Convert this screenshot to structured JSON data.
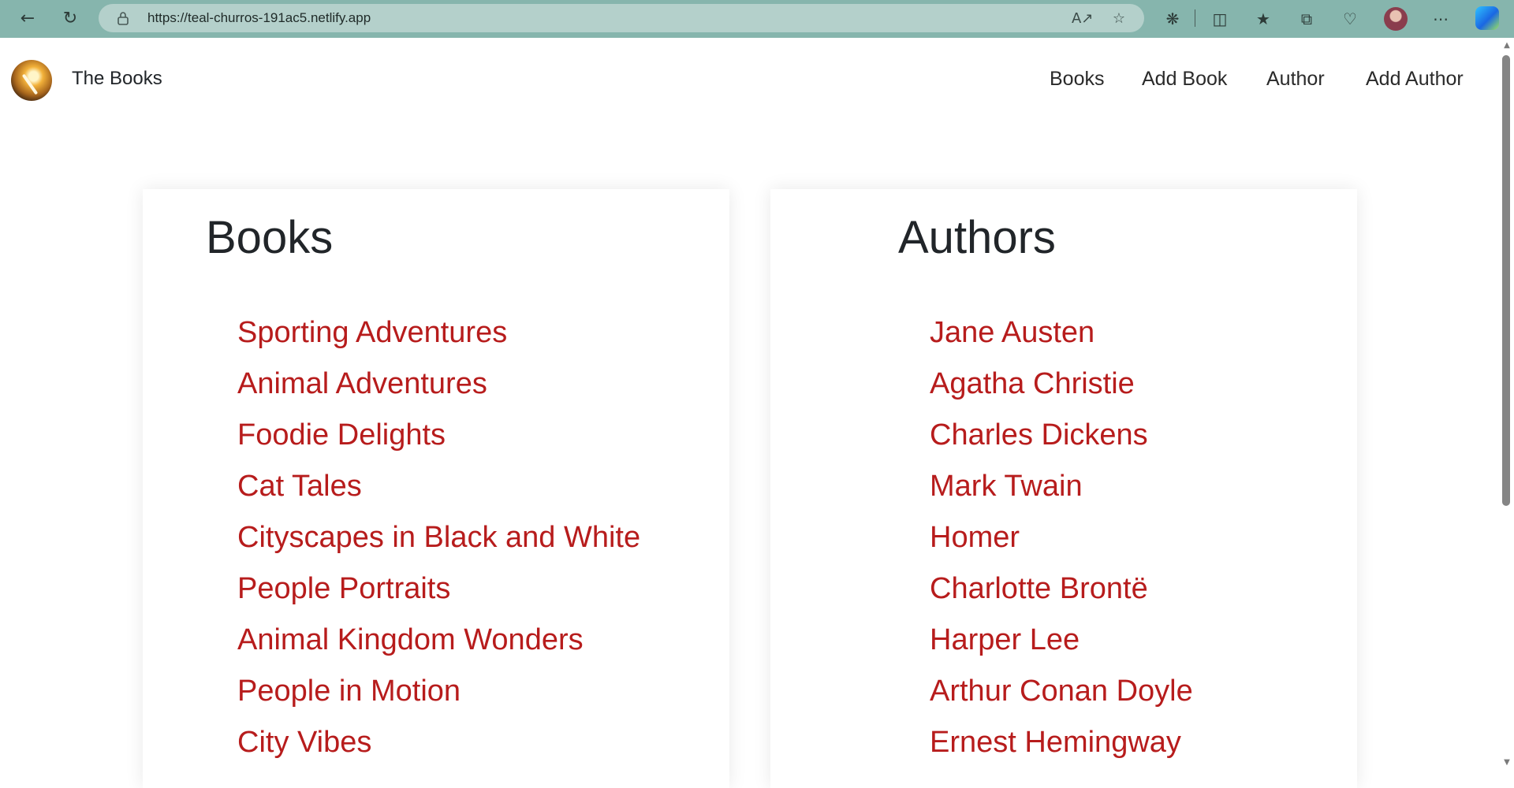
{
  "browser": {
    "url": "https://teal-churros-191ac5.netlify.app",
    "icons": [
      "back-icon",
      "reload-icon",
      "lock-icon",
      "read-aloud-icon",
      "favorite-star-icon",
      "extensions-icon",
      "split-screen-icon",
      "favorites-icon",
      "collections-icon",
      "browser-essentials-icon",
      "profile-avatar",
      "more-icon",
      "copilot-icon"
    ]
  },
  "site": {
    "brand": "The Books",
    "nav": [
      "Books",
      "Add Book",
      "Author",
      "Add Author"
    ]
  },
  "books": {
    "title": "Books",
    "items": [
      "Sporting Adventures",
      "Animal Adventures",
      "Foodie Delights",
      "Cat Tales",
      "Cityscapes in Black and White",
      "People Portraits",
      "Animal Kingdom Wonders",
      "People in Motion",
      "City Vibes"
    ]
  },
  "authors": {
    "title": "Authors",
    "items": [
      "Jane Austen",
      "Agatha Christie",
      "Charles Dickens",
      "Mark Twain",
      "Homer",
      "Charlotte Brontë",
      "Harper Lee",
      "Arthur Conan Doyle",
      "Ernest Hemingway"
    ]
  },
  "colors": {
    "browser_bar": "#86b5ad",
    "link": "#b71c1c",
    "text": "#212529"
  }
}
